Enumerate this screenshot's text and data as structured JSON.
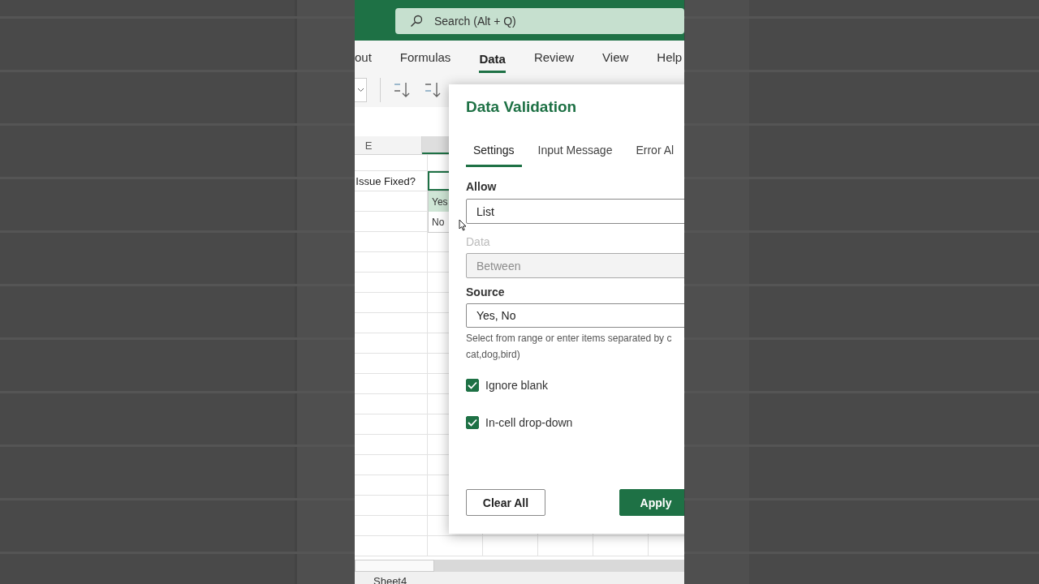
{
  "search": {
    "placeholder": "Search (Alt + Q)"
  },
  "ribbon_tabs": [
    {
      "label": "out",
      "selected": false
    },
    {
      "label": "Formulas",
      "selected": false
    },
    {
      "label": "Data",
      "selected": true
    },
    {
      "label": "Review",
      "selected": false
    },
    {
      "label": "View",
      "selected": false
    },
    {
      "label": "Help",
      "selected": false
    }
  ],
  "sheet": {
    "column_header": "E",
    "cell": "Issue Fixed?",
    "dropdown": [
      {
        "label": "Yes",
        "selected": true
      },
      {
        "label": "No",
        "selected": false
      }
    ],
    "sheet_tab": "Sheet4"
  },
  "dialog": {
    "title": "Data Validation",
    "tabs": [
      {
        "label": "Settings",
        "selected": true
      },
      {
        "label": "Input Message",
        "selected": false
      },
      {
        "label": "Error Al",
        "selected": false
      }
    ],
    "fields": [
      {
        "label": "Allow",
        "value": "List",
        "disabled": false
      },
      {
        "label": "Data",
        "value": "Between",
        "disabled": true
      },
      {
        "label": "Source",
        "value": "Yes, No",
        "disabled": false
      }
    ],
    "hint_lines": [
      "Select from range or enter items separated by c",
      "cat,dog,bird)"
    ],
    "checkboxes": [
      {
        "label": "Ignore blank",
        "checked": true
      },
      {
        "label": "In-cell drop-down",
        "checked": true
      }
    ],
    "buttons": [
      {
        "label": "Clear All",
        "kind": "secondary"
      },
      {
        "label": "Apply",
        "kind": "primary"
      }
    ]
  }
}
